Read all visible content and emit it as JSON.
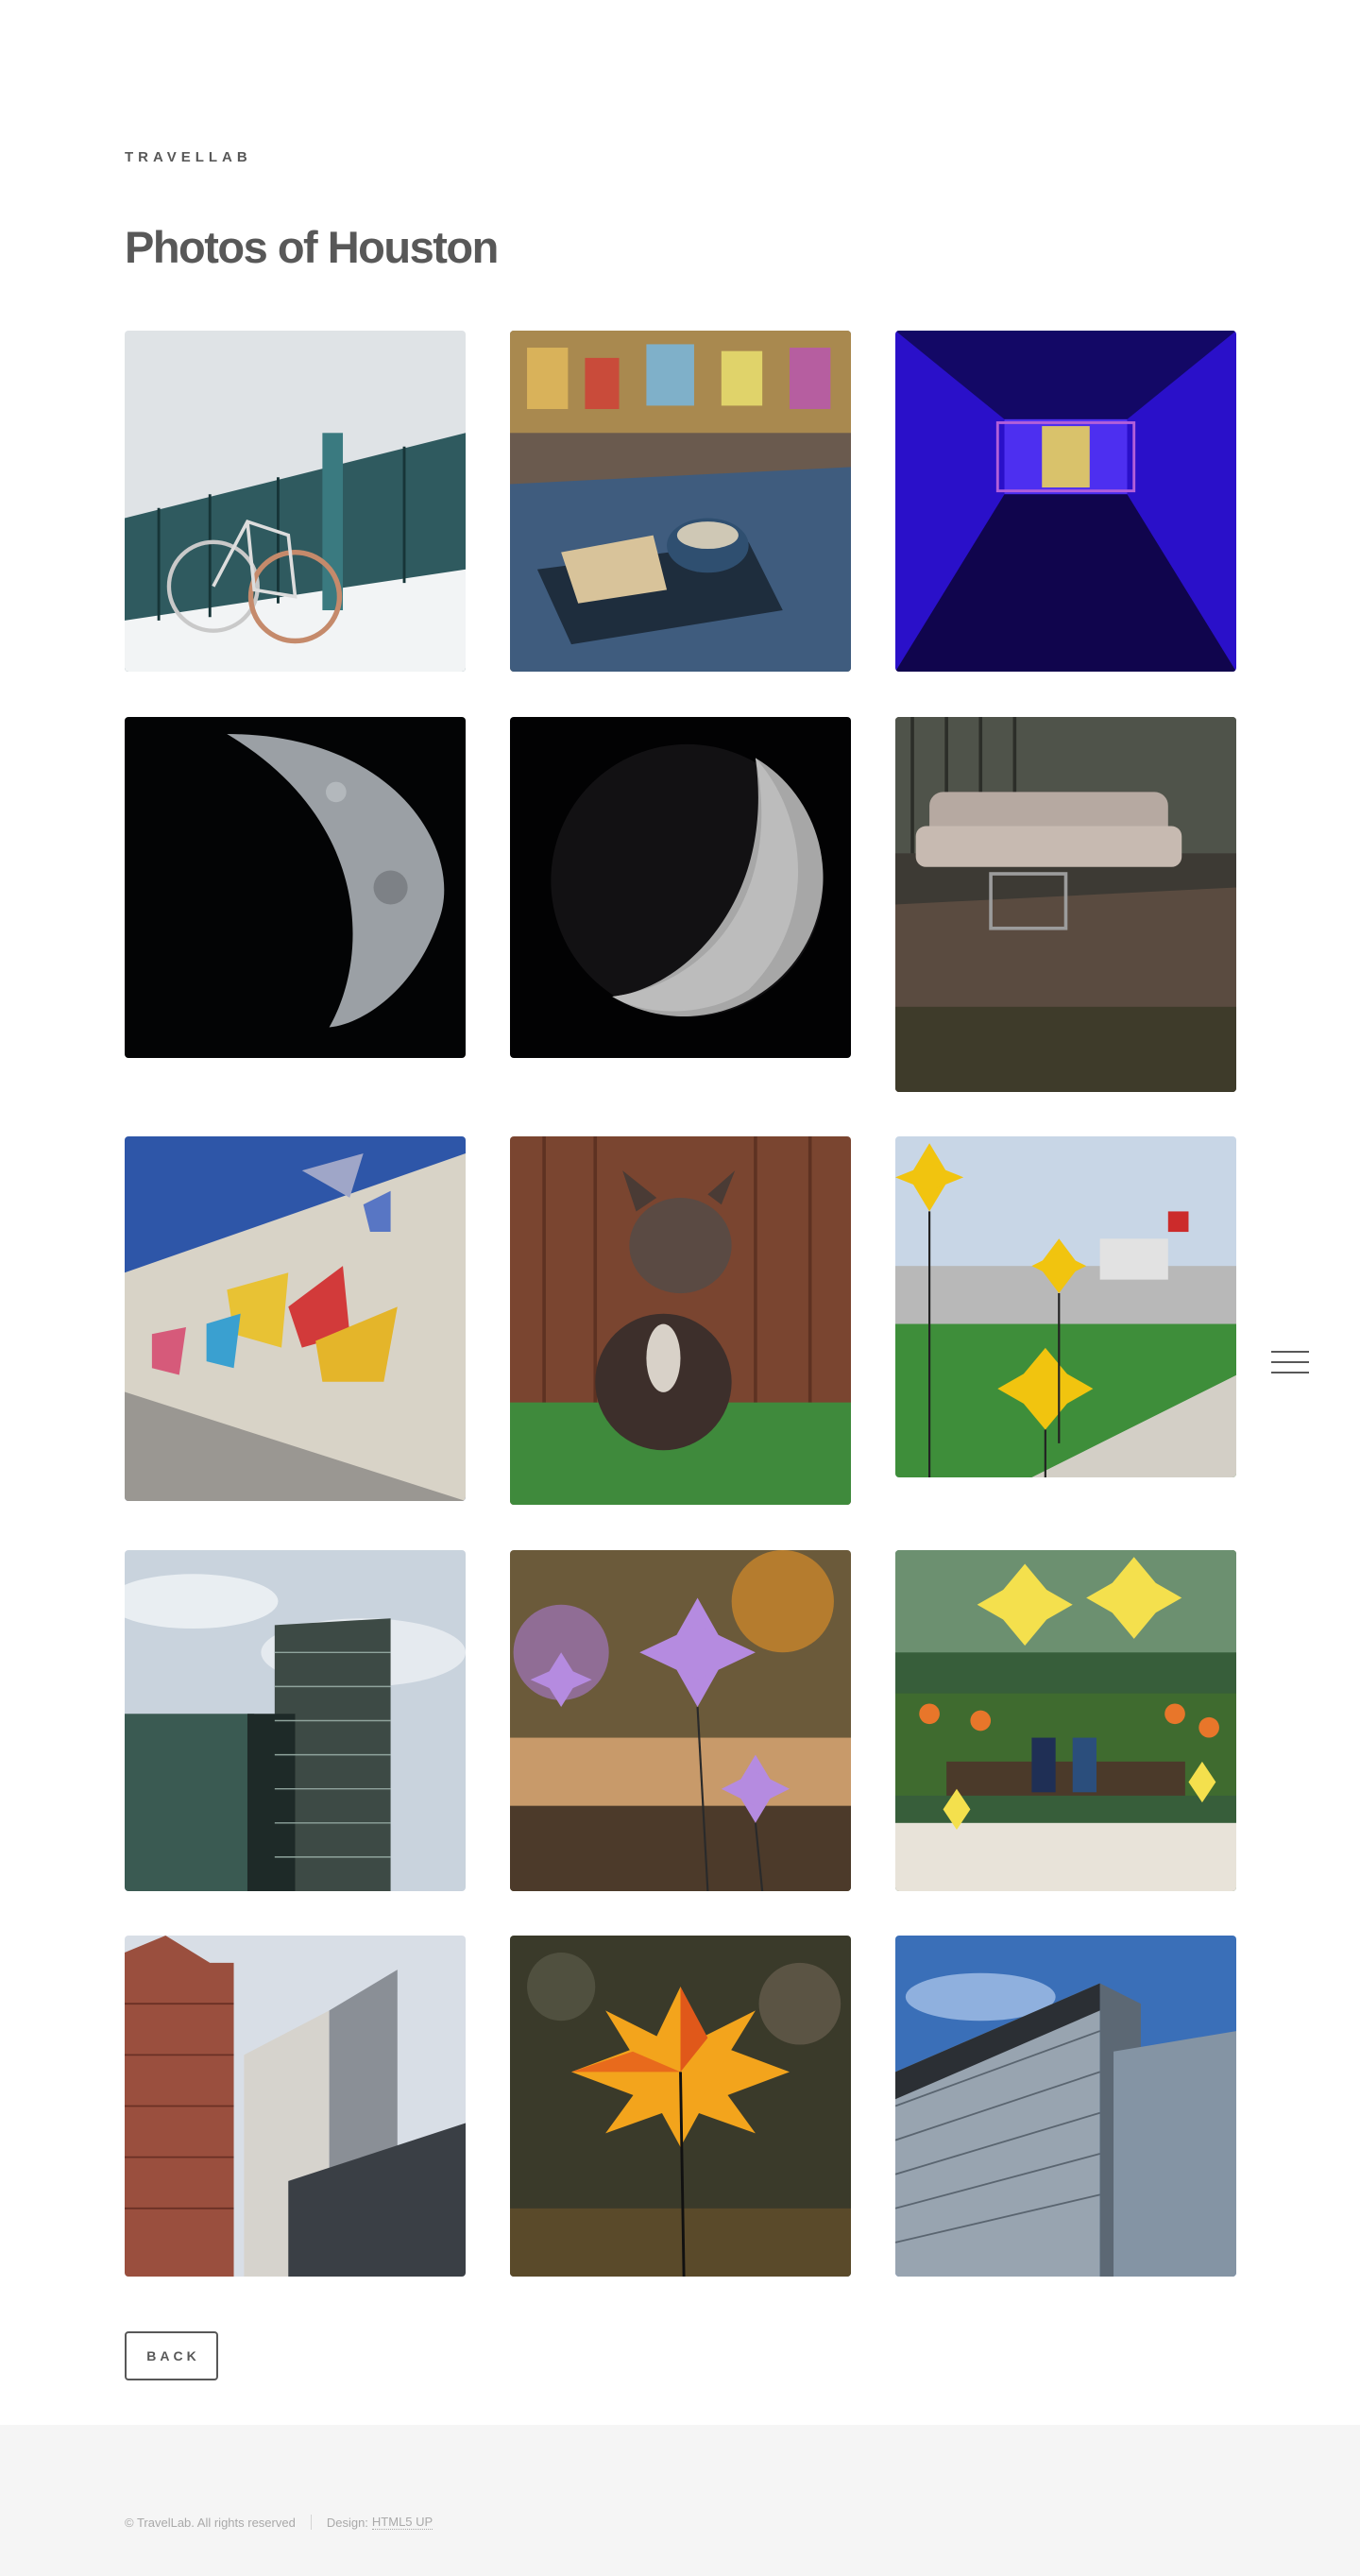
{
  "header": {
    "logo": "TRAVELLAB",
    "title": "Photos of Houston"
  },
  "menu": {
    "icon": "hamburger-menu-icon"
  },
  "gallery": {
    "photos": [
      {
        "subject": "bicycle-against-railing"
      },
      {
        "subject": "sandwich-and-bowl-on-table"
      },
      {
        "subject": "purple-light-tunnel"
      },
      {
        "subject": "half-moon"
      },
      {
        "subject": "crescent-moon"
      },
      {
        "subject": "old-sofa-and-shopping-cart"
      },
      {
        "subject": "butterfly-mural"
      },
      {
        "subject": "dog-sitting-in-grass"
      },
      {
        "subject": "yellow-pinwheels-park"
      },
      {
        "subject": "glass-skyscraper"
      },
      {
        "subject": "purple-pinwheels"
      },
      {
        "subject": "people-on-bench-with-pinwheels"
      },
      {
        "subject": "downtown-towers"
      },
      {
        "subject": "orange-pinwheel"
      },
      {
        "subject": "modern-office-building"
      }
    ]
  },
  "actions": {
    "back_label": "Back"
  },
  "footer": {
    "copyright": "© TravelLab. All rights reserved",
    "design_prefix": "Design:",
    "design_link": "HTML5 UP"
  }
}
